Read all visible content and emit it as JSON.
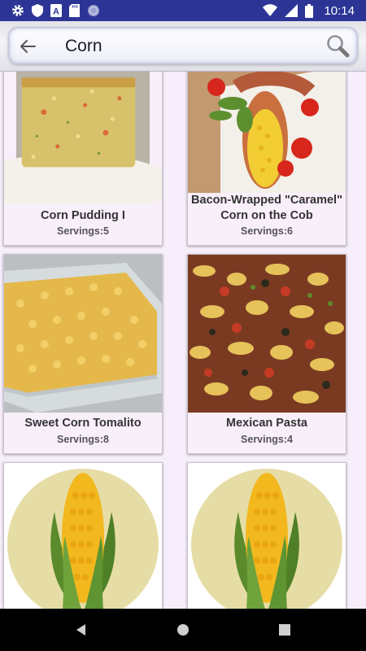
{
  "status_bar": {
    "time": "10:14",
    "left_icons": [
      "gear-icon",
      "shield-icon",
      "font-a-icon",
      "sd-card-icon",
      "sync-circle-icon"
    ],
    "right_icons": [
      "wifi-icon",
      "signal-icon",
      "battery-icon"
    ]
  },
  "search": {
    "query": "Corn",
    "back_icon": "arrow-left-icon",
    "search_icon": "magnifier-icon"
  },
  "recipes": [
    {
      "title": "Corn Pudding I",
      "servings": "Servings:5",
      "image": "corn-pudding-photo"
    },
    {
      "title": "Bacon-Wrapped \"Caramel\" Corn on the Cob",
      "servings": "Servings:6",
      "image": "bacon-corn-photo"
    },
    {
      "title": "Sweet Corn Tomalito",
      "servings": "Servings:8",
      "image": "tomalito-photo"
    },
    {
      "title": "Mexican Pasta",
      "servings": "Servings:4",
      "image": "mexican-pasta-photo"
    },
    {
      "title": "",
      "servings": "",
      "image": "corn-placeholder-icon"
    },
    {
      "title": "",
      "servings": "",
      "image": "corn-placeholder-icon"
    }
  ],
  "nav": {
    "icons": [
      "back-triangle-icon",
      "home-circle-icon",
      "recents-square-icon"
    ]
  },
  "colors": {
    "status_bar": "#2c3596",
    "background": "#f6eefb",
    "card": "#f8effb",
    "nav_bar": "#000000"
  }
}
